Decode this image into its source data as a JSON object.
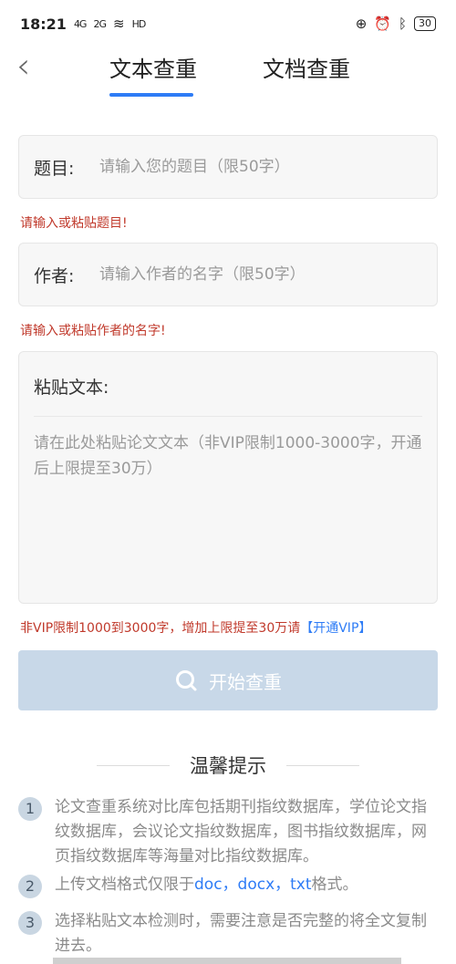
{
  "status_bar": {
    "time": "18:21",
    "signal_1": "4G",
    "signal_2": "2G",
    "hd": "HD",
    "battery": "30"
  },
  "nav": {
    "back": "‹",
    "tabs": [
      {
        "label": "文本查重",
        "active": true
      },
      {
        "label": "文档查重",
        "active": false
      }
    ]
  },
  "form": {
    "title_label": "题目:",
    "title_placeholder": "请输入您的题目（限50字）",
    "title_error": "请输入或粘贴题目!",
    "author_label": "作者:",
    "author_placeholder": "请输入作者的名字（限50字）",
    "author_error": "请输入或粘贴作者的名字!",
    "paste_label": "粘贴文本:",
    "paste_placeholder": "请在此处粘贴论文文本（非VIP限制1000-3000字，开通后上限提至30万）",
    "vip_note": "非VIP限制1000到3000字，增加上限提至30万请",
    "vip_link": "【开通VIP】"
  },
  "start_button": {
    "label": "开始查重"
  },
  "tips": {
    "title": "温馨提示",
    "items": [
      {
        "num": "1",
        "text": "论文查重系统对比库包括期刊指纹数据库，学位论文指纹数据库，会议论文指纹数据库，图书指纹数据库，网页指纹数据库等海量对比指纹数据库。"
      },
      {
        "num": "2",
        "prefix": "上传文档格式仅限于",
        "highlight": "doc，docx，txt",
        "suffix": "格式。"
      },
      {
        "num": "3",
        "text": "选择粘贴文本检测时，需要注意是否完整的将全文复制进去。"
      }
    ]
  },
  "colors": {
    "accent": "#2e7cf6",
    "error": "#c0392b",
    "button_disabled": "#c8d8e8"
  }
}
